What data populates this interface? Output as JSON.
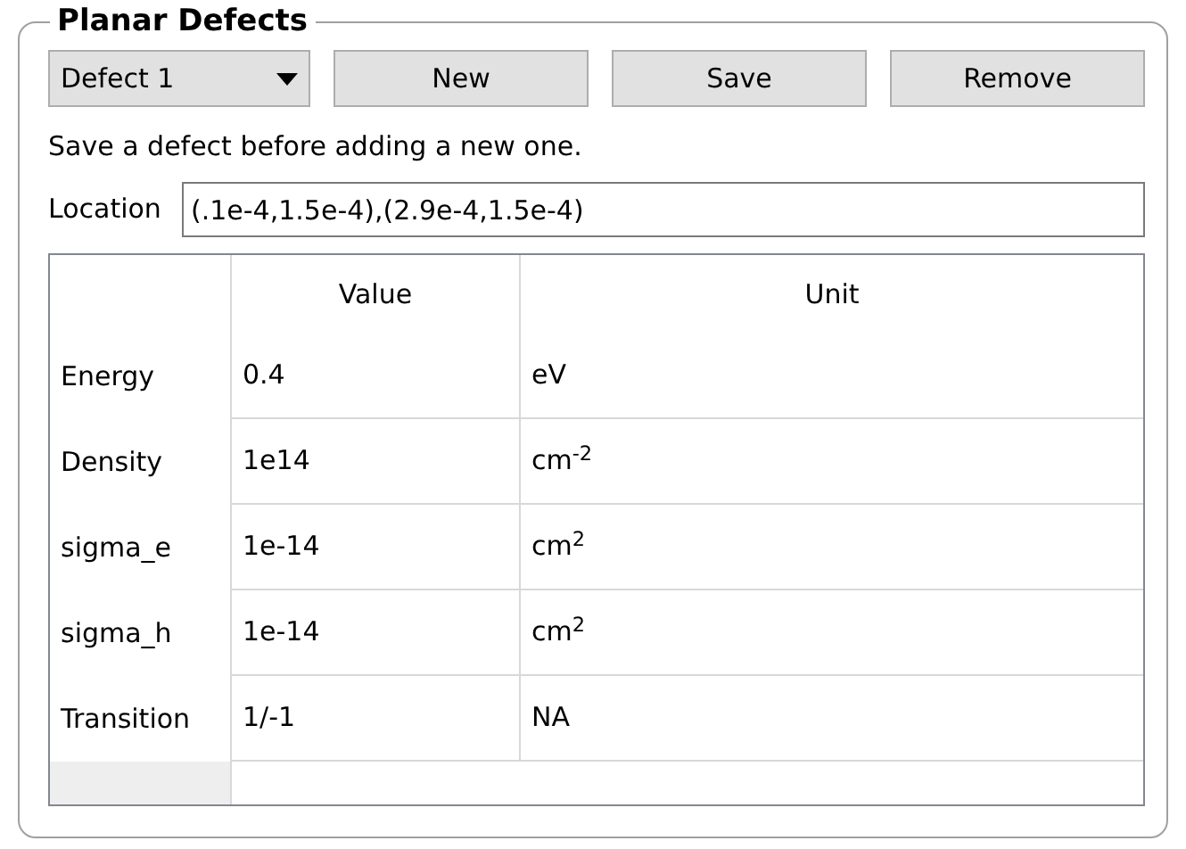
{
  "group": {
    "title": "Planar Defects"
  },
  "defect_select": {
    "value": "Defect 1"
  },
  "buttons": [
    "New",
    "Save",
    "Remove"
  ],
  "message": "Save a defect before adding a new one.",
  "location": {
    "label": "Location",
    "value": "(.1e-4,1.5e-4),(2.9e-4,1.5e-4)"
  },
  "table": {
    "columns": [
      "Value",
      "Unit"
    ],
    "rows": [
      {
        "label": "Energy",
        "value": "0.4",
        "unit": "eV"
      },
      {
        "label": "Density",
        "value": "1e14",
        "unit": "cm$^{-2}$"
      },
      {
        "label": "sigma_e",
        "value": "1e-14",
        "unit": "cm$^{2}$"
      },
      {
        "label": "sigma_h",
        "value": "1e-14",
        "unit": "cm$^{2}$"
      },
      {
        "label": "Transition",
        "value": "1/-1",
        "unit": "NA"
      }
    ]
  }
}
